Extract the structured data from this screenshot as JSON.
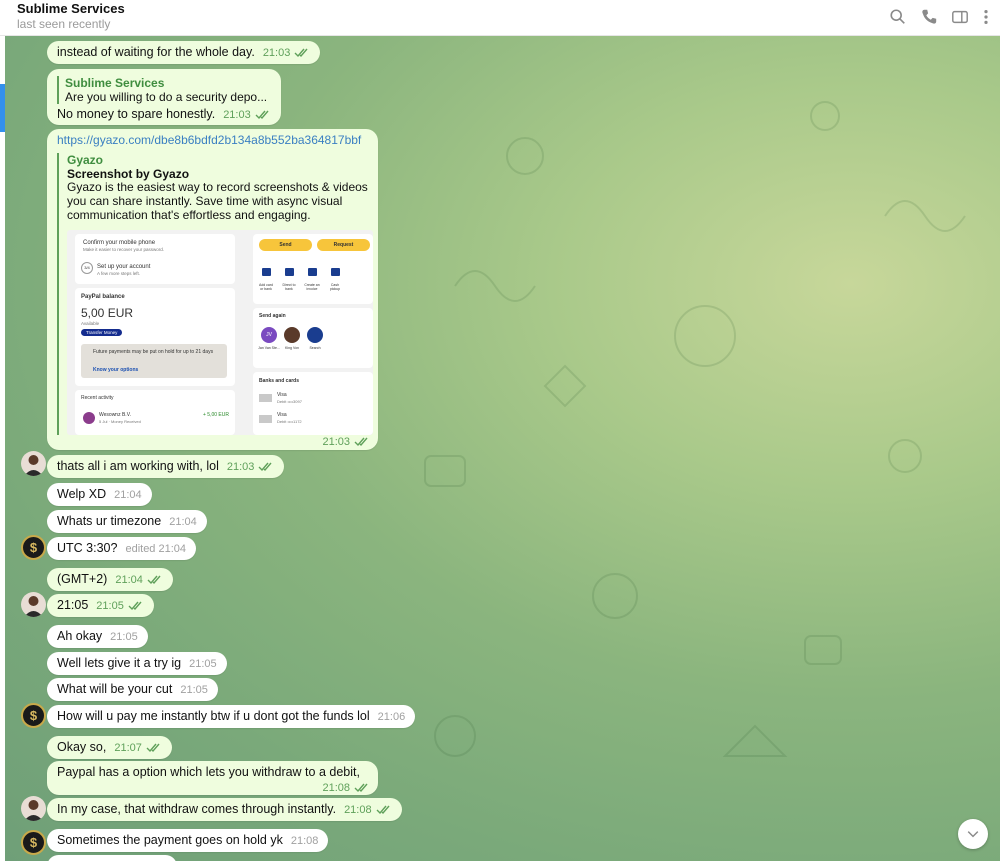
{
  "header": {
    "title": "Sublime Services",
    "status": "last seen recently",
    "icons": [
      "search-icon",
      "phone-icon",
      "sidebar-toggle-icon",
      "more-vertical-icon"
    ]
  },
  "colors": {
    "outgoing_bubble": "#effdde",
    "incoming_bubble": "#ffffff",
    "accent": "#3390ec",
    "time_out": "#5fa05a"
  },
  "messages": [
    {
      "text": "instead of waiting for the whole day.",
      "time": "21:03"
    },
    {
      "reply_name": "Sublime Services",
      "reply_text": "Are you willing to do a security depo...",
      "text": "No money to spare honestly.",
      "time": "21:03"
    },
    {
      "link": "https://gyazo.com/dbe8b6bdfd2b134a8b552ba364817bbf",
      "site": "Gyazo",
      "title": "Screenshot by Gyazo",
      "desc": "Gyazo is the easiest way to record screenshots & videos you can share instantly. Save time with async visual communication that's effortless and engaging.",
      "time": "21:03"
    },
    {
      "text": "thats all i am working with, lol",
      "time": "21:03"
    },
    {
      "text": "Welp XD",
      "time": "21:04"
    },
    {
      "text": "Whats ur timezone",
      "time": "21:04"
    },
    {
      "text": "UTC 3:30?",
      "time": "edited 21:04"
    },
    {
      "text": "(GMT+2)",
      "time": "21:04"
    },
    {
      "text": "21:05",
      "time": "21:05"
    },
    {
      "text": "Ah okay",
      "time": "21:05"
    },
    {
      "text": "Well lets give it a try ig",
      "time": "21:05"
    },
    {
      "text": "What will be your cut",
      "time": "21:05"
    },
    {
      "text": "How will u pay me instantly btw if u dont got the funds lol",
      "time": "21:06"
    },
    {
      "text": "Okay so,",
      "time": "21:07"
    },
    {
      "text": "Paypal has a option which lets you withdraw to a debit,",
      "time": "21:08"
    },
    {
      "text": "In my case, that withdraw comes through instantly.",
      "time": "21:08"
    },
    {
      "text": "Sometimes the payment goes on hold yk",
      "time": "21:08"
    }
  ],
  "preview": {
    "confirm_phone": "Confirm your mobile phone",
    "confirm_phone_sub": "Make it easier to recover your password.",
    "setup_account": "Set up your account",
    "setup_sub": "A few more steps left.",
    "setup_progress": "3/4",
    "balance_label": "PayPal balance",
    "balance": "5,00 EUR",
    "available": "Available",
    "transfer": "Transfer Money",
    "hold_note": "Future payments may be put on hold for up to 21 days",
    "know_options": "Know your options",
    "recent": "Recent activity",
    "recent_name": "Wesownz B.V.",
    "recent_sub": "5 Jul · Money Received",
    "recent_amount": "+ 5,00 EUR",
    "send": "Send",
    "request": "Request",
    "actions": [
      "Add card or bank",
      "Direct to bank",
      "Create an invoice",
      "Cash pickup"
    ],
    "send_again": "Send again",
    "contacts": [
      "Jan Van Ste...",
      "King Von",
      "Search"
    ],
    "contact_initials": "JV",
    "banks": "Banks and cards",
    "card1": "Visa",
    "card1_sub": "Debit ••••3097",
    "card2": "Visa",
    "card2_sub": "Debit ••••1172"
  }
}
